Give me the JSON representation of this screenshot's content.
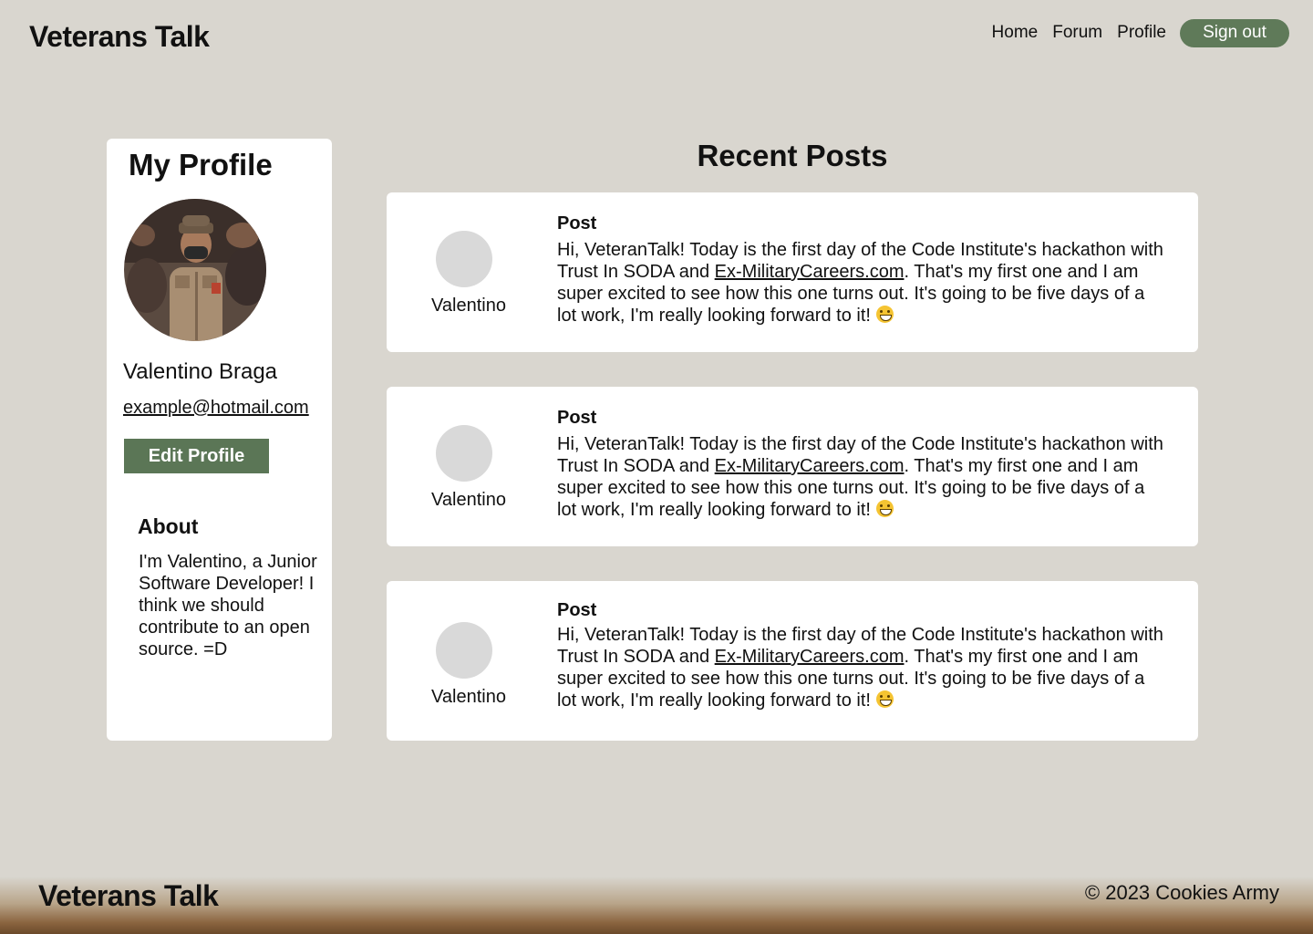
{
  "header": {
    "brand": "Veterans Talk",
    "nav": [
      "Home",
      "Forum",
      "Profile"
    ],
    "signout_label": "Sign out"
  },
  "profile": {
    "title": "My Profile",
    "name": "Valentino Braga",
    "email": "example@hotmail.com",
    "edit_label": "Edit Profile",
    "about_title": "About",
    "about_text": "I'm Valentino, a Junior Software Developer! I think we should contribute to an open source. =D"
  },
  "posts": {
    "title": "Recent Posts",
    "items": [
      {
        "author": "Valentino",
        "label": "Post",
        "text_before": "Hi, VeteranTalk! Today is the first day of the Code Institute's hackathon with Trust In SODA and ",
        "link": "Ex-MilitaryCareers.com",
        "text_after": ". That's my first one and I am super excited to see how this one turns out. It's going to be five days of a lot work, I'm really looking forward to it! "
      },
      {
        "author": "Valentino",
        "label": "Post",
        "text_before": "Hi, VeteranTalk! Today is the first day of the Code Institute's hackathon with Trust In SODA and ",
        "link": "Ex-MilitaryCareers.com",
        "text_after": ". That's my first one and I am super excited to see how this one turns out. It's going to be five days of a lot work, I'm really looking forward to it! "
      },
      {
        "author": "Valentino",
        "label": "Post",
        "text_before": "Hi, VeteranTalk! Today is the first day of the Code Institute's hackathon with Trust In SODA and ",
        "link": "Ex-MilitaryCareers.com",
        "text_after": ". That's my first one and I am super excited to see how this one turns out. It's going to be five days of a lot work, I'm really looking forward to it! "
      }
    ]
  },
  "footer": {
    "brand": "Veterans Talk",
    "copyright": "© 2023 Cookies Army"
  },
  "colors": {
    "background": "#d9d6cf",
    "accent_green": "#5f7a59",
    "card": "#ffffff"
  },
  "icons": {
    "post_emoji": "grinning-face-icon"
  }
}
